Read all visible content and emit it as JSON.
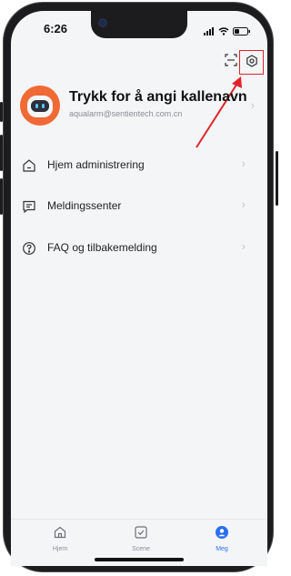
{
  "status_bar": {
    "time": "6:26"
  },
  "profile": {
    "name": "Trykk for å angi kallenavn",
    "email": "aqualarm@sentientech.com.cn"
  },
  "menu": [
    {
      "label": "Hjem administrering",
      "icon": "home-icon"
    },
    {
      "label": "Meldingssenter",
      "icon": "message-icon"
    },
    {
      "label": "FAQ og tilbakemelding",
      "icon": "help-icon"
    }
  ],
  "tabs": [
    {
      "label": "Hjem",
      "icon": "home-icon",
      "active": false
    },
    {
      "label": "Scene",
      "icon": "scene-check-icon",
      "active": false
    },
    {
      "label": "Meg",
      "icon": "person-icon",
      "active": true
    }
  ],
  "colors": {
    "accent": "#2a6ff5",
    "annotation": "#e0242b",
    "avatar": "#f06a35"
  }
}
